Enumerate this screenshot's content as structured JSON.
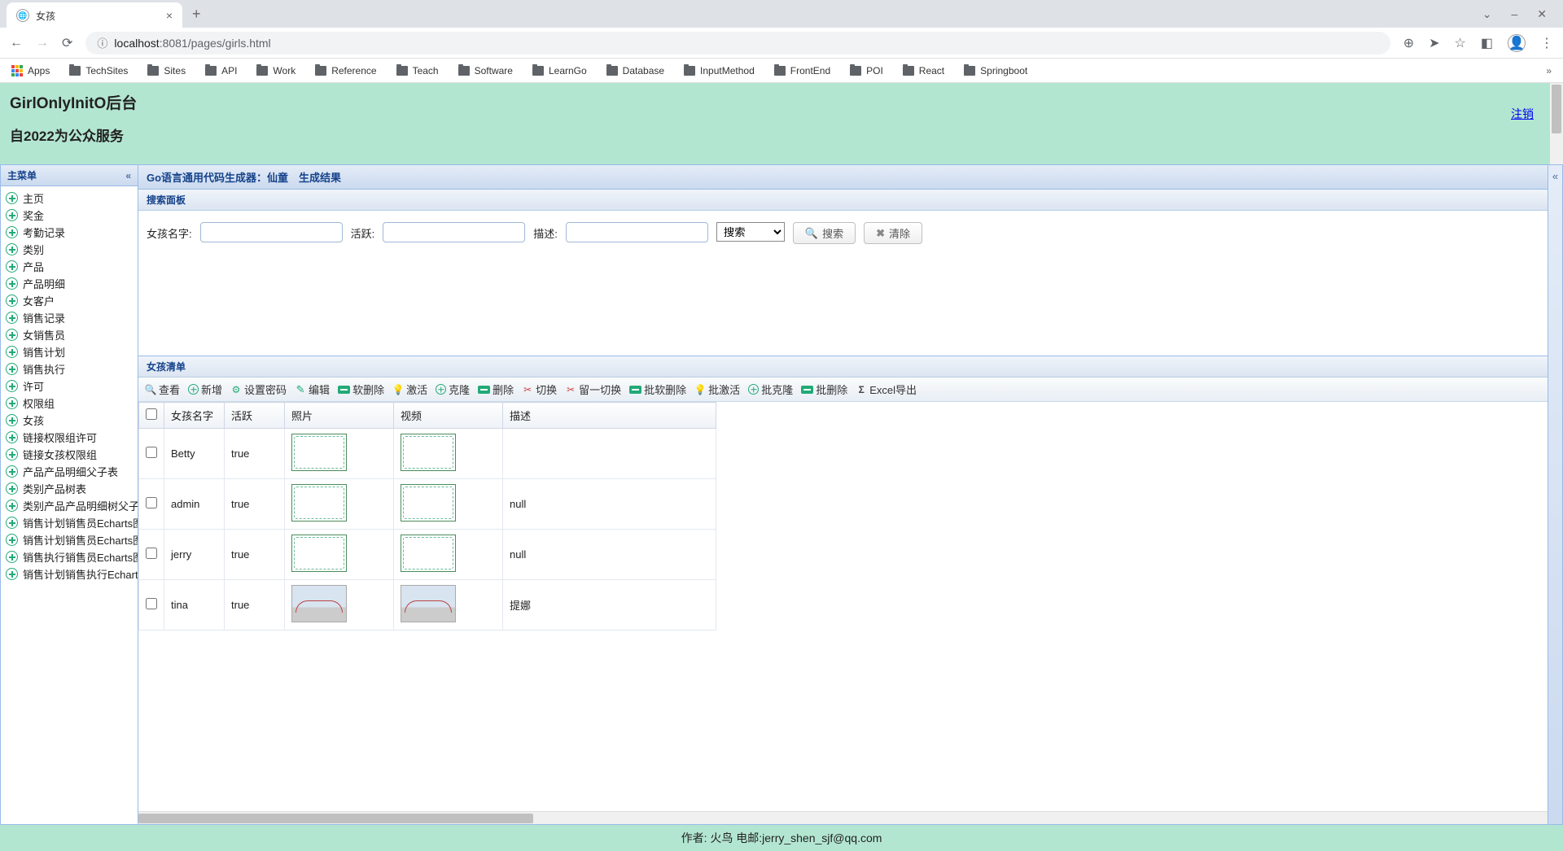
{
  "browser": {
    "tab_title": "女孩",
    "url_host": "localhost",
    "url_port": ":8081",
    "url_path": "/pages/girls.html",
    "apps_label": "Apps",
    "bookmarks": [
      "TechSites",
      "Sites",
      "API",
      "Work",
      "Reference",
      "Teach",
      "Software",
      "LearnGo",
      "Database",
      "InputMethod",
      "FrontEnd",
      "POI",
      "React",
      "Springboot"
    ]
  },
  "header": {
    "title": "GirlOnlyInitO后台",
    "subtitle": "自2022为公众服务",
    "logout": "注销"
  },
  "sidebar": {
    "title": "主菜单",
    "items": [
      "主页",
      "奖金",
      "考勤记录",
      "类别",
      "产品",
      "产品明细",
      "女客户",
      "销售记录",
      "女销售员",
      "销售计划",
      "销售执行",
      "许可",
      "权限组",
      "女孩",
      "链接权限组许可",
      "链接女孩权限组",
      "产品产品明细父子表",
      "类别产品树表",
      "类别产品产品明细树父子表",
      "销售计划销售员Echarts图表",
      "销售计划销售员Echarts图表",
      "销售执行销售员Echarts图表",
      "销售计划销售执行Echarts图表"
    ]
  },
  "content_title": "Go语言通用代码生成器：仙童　生成结果",
  "search_panel": {
    "title": "搜索面板",
    "labels": {
      "name": "女孩名字:",
      "active": "活跃:",
      "desc": "描述:"
    },
    "select_default": "搜索",
    "btn_search": "搜索",
    "btn_clear": "清除"
  },
  "list_panel": {
    "title": "女孩清单",
    "toolbar": {
      "view": "查看",
      "add": "新增",
      "setpwd": "设置密码",
      "edit": "编辑",
      "softdel": "软删除",
      "activate": "激活",
      "clone": "克隆",
      "delete": "删除",
      "toggle": "切换",
      "toggleall": "留一切换",
      "batchsoftdel": "批软删除",
      "batchactivate": "批激活",
      "batchclone": "批克隆",
      "batchdel": "批删除",
      "excel": "Excel导出"
    },
    "columns": {
      "name": "女孩名字",
      "active": "活跃",
      "photo": "照片",
      "video": "视频",
      "desc": "描述"
    },
    "rows": [
      {
        "name": "Betty",
        "active": "true",
        "photo_kind": "vine",
        "video_kind": "vine",
        "desc": ""
      },
      {
        "name": "admin",
        "active": "true",
        "photo_kind": "vine",
        "video_kind": "vine",
        "desc": "null"
      },
      {
        "name": "jerry",
        "active": "true",
        "photo_kind": "vine",
        "video_kind": "vine",
        "desc": "null"
      },
      {
        "name": "tina",
        "active": "true",
        "photo_kind": "bridge",
        "video_kind": "bridge",
        "desc": "提娜"
      }
    ]
  },
  "footer": "作者: 火鸟 电邮:jerry_shen_sjf@qq.com"
}
